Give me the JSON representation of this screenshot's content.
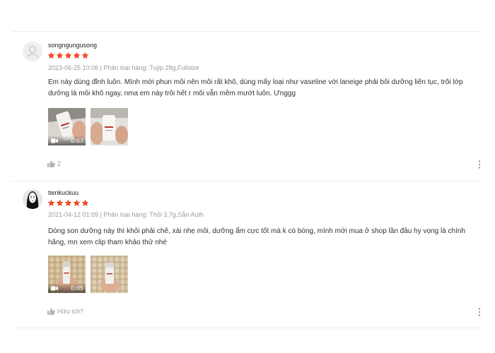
{
  "reviews": [
    {
      "username": "songngungusong",
      "rating": 5,
      "meta": "2023-06-25 10:06 | Phân loại hàng: Tuýp 28g,Fullsize",
      "text": "Em này dùng đỉnh luôn. Mình mới phun môi nên môi rất khô, dùng mấy loại như vaseline với laneige phải bôi dưỡng liên tục, trôi lớp dưỡng là môi khô ngay, nma em này trôi hết r môi vẫn mềm mướt luôn. Ưnggg",
      "media": [
        {
          "type": "video",
          "duration": "0:07"
        },
        {
          "type": "image"
        }
      ],
      "like_label": "2"
    },
    {
      "username": "tienkuckuu",
      "rating": 5,
      "meta": "2021-04-12 01:09 | Phân loại hàng: Thỏi 3,7g,Sẵn Auth",
      "text": "Dòng son dưỡng này thì khỏi phải chê, xài nhẹ môi, dưỡng ẩm cực tốt mà k có bóng, mình mới mua ở shop lần đầu hy vọng là chính hãng, mn xem clip tham khảo thử nhé",
      "media": [
        {
          "type": "video",
          "duration": "0:05"
        },
        {
          "type": "image"
        }
      ],
      "like_label": "Hữu ích?"
    }
  ],
  "icons": {
    "star": "star-icon",
    "like": "thumbs-up-icon",
    "more": "more-vertical-icon",
    "video": "video-camera-icon",
    "avatar_default": "user-icon",
    "avatar_custom": "no-face-avatar"
  },
  "colors": {
    "star": "#ee4d2d",
    "meta_text": "#9a9a9a",
    "body_text": "#333333",
    "divider": "#eeeeee"
  }
}
